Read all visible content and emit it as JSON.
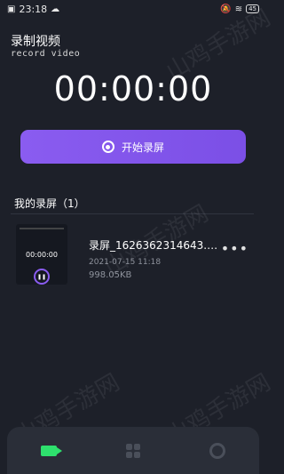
{
  "status_bar": {
    "time": "23:18",
    "battery": "45"
  },
  "header": {
    "title": "录制视频",
    "subtitle": "record video"
  },
  "timer": "00:00:00",
  "start_button": {
    "label": "开始录屏"
  },
  "recordings": {
    "section_title": "我的录屏（1）",
    "items": [
      {
        "thumb_time": "00:00:00",
        "name": "录屏_1626362314643.…",
        "date": "2021-07-15 11:18",
        "size": "998.05KB"
      }
    ]
  },
  "bottom_nav": {
    "items": [
      "camera-icon",
      "grid-icon",
      "settings-icon"
    ]
  },
  "colors": {
    "background": "#1d2029",
    "accent": "#8a5cf0",
    "active_nav": "#2ee06d"
  },
  "watermark": "山鸡手游网"
}
